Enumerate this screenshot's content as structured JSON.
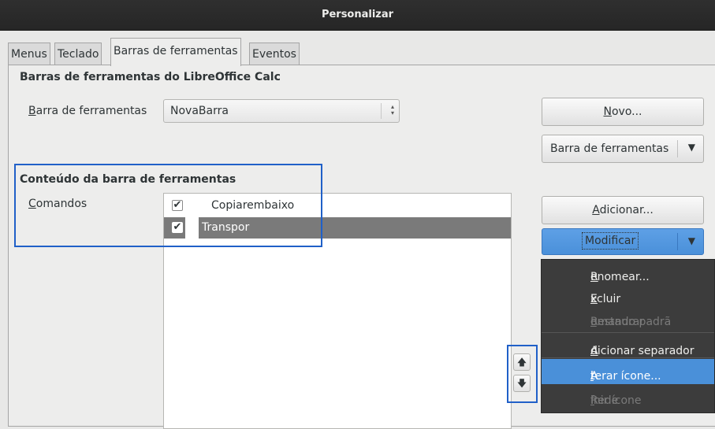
{
  "window": {
    "title": "Personalizar"
  },
  "tabs": [
    {
      "label": "Menus",
      "active": false
    },
    {
      "label": "Teclado",
      "active": false
    },
    {
      "label": "Barras de ferramentas",
      "active": true
    },
    {
      "label": "Eventos",
      "active": false
    }
  ],
  "toolbars_section": {
    "title": "Barras de ferramentas do LibreOffice Calc",
    "toolbar_label": "Barra de ferramentas",
    "toolbar_label_mnemonic": "B",
    "toolbar_label_rest": "arra de ferramentas",
    "selected_toolbar": "NovaBarra",
    "new_button": {
      "label": "Novo...",
      "mnemonic": "N",
      "rest": "ovo..."
    },
    "toolbar_menu_button": "Barra de ferramentas"
  },
  "content_section": {
    "title": "Conteúdo da barra de ferramentas",
    "commands_label": "Comandos",
    "commands_mnemonic": "C",
    "commands_rest": "omandos",
    "commands": [
      {
        "label": "Copiarembaixo",
        "checked": true,
        "selected": false
      },
      {
        "label": "Transpor",
        "checked": true,
        "selected": true
      }
    ],
    "add_button": {
      "label": "Adicionar...",
      "mnemonic": "A",
      "rest": "dicionar..."
    },
    "modify_button": {
      "label": "Modificar"
    }
  },
  "modify_menu": {
    "items": [
      {
        "pre": "",
        "mn": "R",
        "post": "enomear...",
        "disabled": false,
        "highlighted": false
      },
      {
        "pre": "",
        "mn": "E",
        "post": "xcluir",
        "disabled": false,
        "highlighted": false
      },
      {
        "pre": "Restaurar ",
        "mn": "c",
        "post": "omando padrã",
        "disabled": true,
        "highlighted": false
      },
      {
        "pre": "",
        "mn": "A",
        "post": "dicionar separador",
        "disabled": false,
        "highlighted": false
      },
      {
        "pre": "A",
        "mn": "l",
        "post": "terar ícone...",
        "disabled": false,
        "highlighted": true
      },
      {
        "pre": "Rede",
        "mn": "f",
        "post": "inir ícone",
        "disabled": true,
        "highlighted": false
      }
    ]
  },
  "icons": {
    "check": "✔",
    "spin": "▴▾",
    "dropdown": "▼",
    "move_up": "🡅",
    "move_down": "🡇"
  },
  "colors": {
    "accent": "#4a90d9",
    "annotation_outline": "#2060c8",
    "selection_row": "#7a7a7a",
    "menu_bg": "#3c3c3c"
  }
}
